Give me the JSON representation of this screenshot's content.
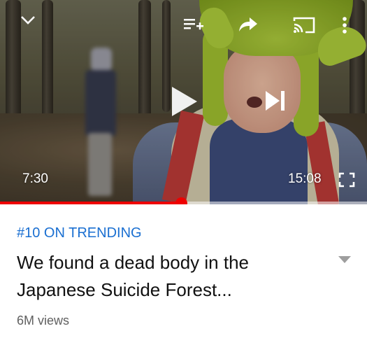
{
  "player": {
    "current_time": "7:30",
    "duration": "15:08",
    "progress": 0.494,
    "colors": {
      "accent": "#ee0000"
    },
    "icons": [
      "chevron-down-icon",
      "add-to-queue-icon",
      "share-icon",
      "cast-icon",
      "more-vert-icon",
      "play-icon",
      "skip-next-icon",
      "fullscreen-icon"
    ]
  },
  "video": {
    "trending_label": "#10 ON TRENDING",
    "title": "We found a dead body in the Japanese Suicide Forest...",
    "views": "6M views",
    "colors": {
      "trending": "#1a6fd1"
    }
  }
}
